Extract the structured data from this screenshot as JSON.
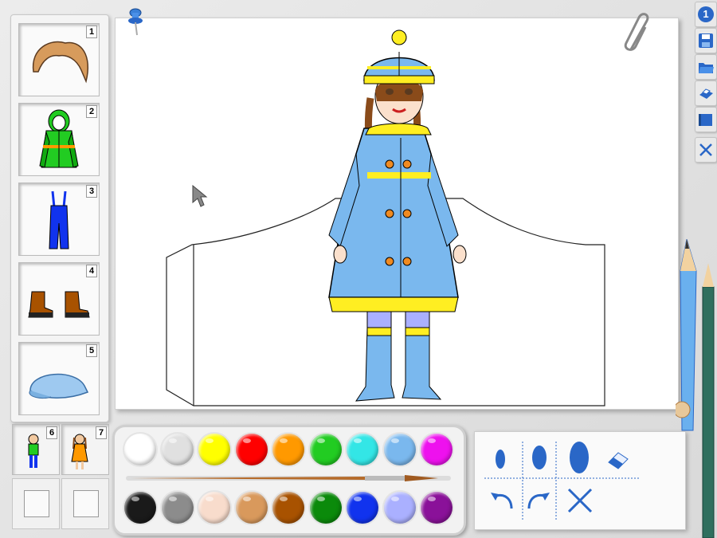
{
  "wardrobe": {
    "slots": [
      {
        "number": "1",
        "item": "hair"
      },
      {
        "number": "2",
        "item": "jacket"
      },
      {
        "number": "3",
        "item": "overalls"
      },
      {
        "number": "4",
        "item": "boots"
      },
      {
        "number": "5",
        "item": "cap"
      }
    ],
    "characters": [
      {
        "number": "6",
        "item": "boy"
      },
      {
        "number": "7",
        "item": "girl"
      }
    ]
  },
  "toolbar": {
    "page_badge": "1",
    "buttons": [
      "save-icon",
      "open-folder-icon",
      "print-icon",
      "blue-book-icon",
      "close-icon"
    ]
  },
  "palette": {
    "top_row": [
      "#ffffff",
      "#e0e0e0",
      "#ffff00",
      "#ff0000",
      "#ff9900",
      "#22cc22",
      "#33e6e6",
      "#7ab8ee",
      "#ee11ee"
    ],
    "bottom_row": [
      "#1a1a1a",
      "#8c8c8c",
      "#f8dccc",
      "#d9995c",
      "#a85200",
      "#0b8a0b",
      "#1133ee",
      "#aab0ff",
      "#8a1199"
    ]
  },
  "tools": {
    "brush_sizes": [
      "small",
      "medium",
      "large"
    ],
    "items": [
      "eraser-icon",
      "undo-icon",
      "redo-icon",
      "clear-icon"
    ]
  },
  "colors": {
    "coat": "#7ab8ee",
    "trim": "#ffee22",
    "buttons": "#f08a20",
    "accent_blue": "#2a67c7"
  }
}
